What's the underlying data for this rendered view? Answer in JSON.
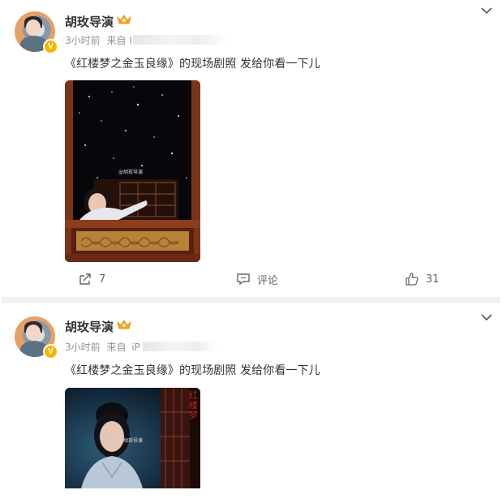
{
  "posts": [
    {
      "author": "胡玫导演",
      "time": "3小时前",
      "source_label": "来自",
      "source_value": "I",
      "content": "《红楼梦之金玉良缘》的现场剧照 发给你看一下儿",
      "verified_badge": "V",
      "image_watermark": "@胡玫导演",
      "actions": {
        "repost_count": "7",
        "comment_label": "评论",
        "like_count": "31"
      }
    },
    {
      "author": "胡玫导演",
      "time": "3小时前",
      "source_label": "来自",
      "source_value": "iP",
      "content": "《红楼梦之金玉良缘》的现场剧照 发给你看一下儿",
      "verified_badge": "V",
      "image_watermark": "@胡玫导演",
      "poster_text": "红楼梦"
    }
  ],
  "colors": {
    "verified": "#f7b500",
    "divider": "#f1f2f5",
    "meta": "#939393",
    "text": "#333333"
  },
  "icons": {
    "verified": "verified-badge-icon",
    "crown": "crown-icon",
    "more": "chevron-down-icon",
    "repost": "repost-icon",
    "comment": "comment-icon",
    "like": "like-icon"
  }
}
